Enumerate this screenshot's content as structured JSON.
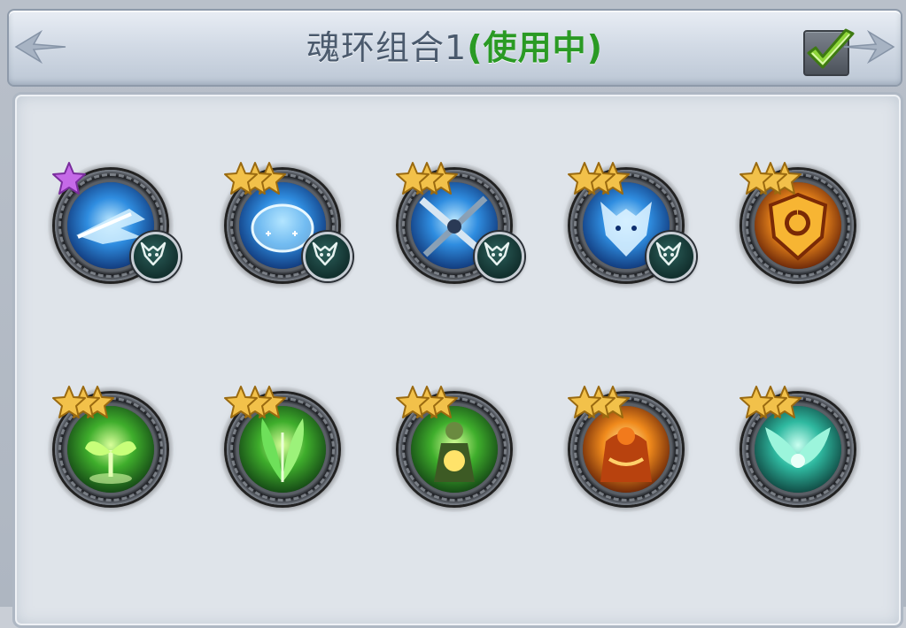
{
  "header": {
    "title": "魂环组合1",
    "status": "(使用中)",
    "confirm_icon": "checkmark-icon"
  },
  "colors": {
    "status_green": "#2a9a24",
    "title_gray": "#4b5a6d",
    "star_gold": "#f2c14a",
    "star_purple": "#c56ae8"
  },
  "rings": [
    {
      "name": "ice-dragon-ring",
      "icon": "ice-dragon-icon",
      "theme": "blue",
      "stars": 1,
      "star_color": "purple",
      "badge": true
    },
    {
      "name": "water-orb-ring",
      "icon": "water-orb-icon",
      "theme": "blue",
      "stars": 3,
      "star_color": "gold",
      "badge": true
    },
    {
      "name": "crossed-blades-ring",
      "icon": "crossed-blades-icon",
      "theme": "blue",
      "stars": 3,
      "star_color": "gold",
      "badge": true
    },
    {
      "name": "frost-wolf-ring",
      "icon": "wolf-head-icon",
      "theme": "blue",
      "stars": 3,
      "star_color": "gold",
      "badge": true
    },
    {
      "name": "flame-shield-ring",
      "icon": "flame-shield-icon",
      "theme": "orange",
      "stars": 3,
      "star_color": "gold",
      "badge": false
    },
    {
      "name": "sprout-ring",
      "icon": "sprout-icon",
      "theme": "green",
      "stars": 3,
      "star_color": "gold",
      "badge": false
    },
    {
      "name": "leaf-burst-ring",
      "icon": "leaf-burst-icon",
      "theme": "green",
      "stars": 3,
      "star_color": "gold",
      "badge": false
    },
    {
      "name": "nature-guardian-ring",
      "icon": "guardian-figure-icon",
      "theme": "green",
      "stars": 3,
      "star_color": "gold",
      "badge": false
    },
    {
      "name": "fire-titan-ring",
      "icon": "fire-titan-icon",
      "theme": "orange",
      "stars": 3,
      "star_color": "gold",
      "badge": false
    },
    {
      "name": "jade-wings-ring",
      "icon": "wings-icon",
      "theme": "teal",
      "stars": 3,
      "star_color": "gold",
      "badge": false
    }
  ]
}
